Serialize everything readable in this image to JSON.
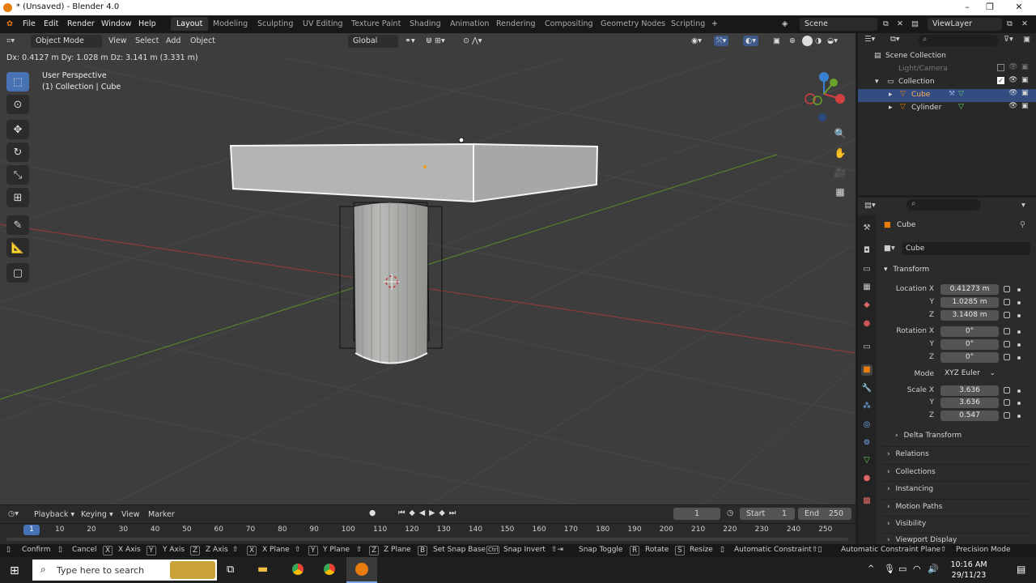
{
  "window": {
    "title": "* (Unsaved) - Blender 4.0"
  },
  "menu": [
    "File",
    "Edit",
    "Render",
    "Window",
    "Help"
  ],
  "workspaces": [
    {
      "label": "Layout",
      "active": true
    },
    {
      "label": "Modeling"
    },
    {
      "label": "Sculpting"
    },
    {
      "label": "UV Editing"
    },
    {
      "label": "Texture Paint"
    },
    {
      "label": "Shading"
    },
    {
      "label": "Animation"
    },
    {
      "label": "Rendering"
    },
    {
      "label": "Compositing"
    },
    {
      "label": "Geometry Nodes"
    },
    {
      "label": "Scripting"
    }
  ],
  "scene": {
    "name": "Scene",
    "view_layer": "ViewLayer"
  },
  "viewport_header": {
    "mode": "Object Mode",
    "menus": [
      "View",
      "Select",
      "Add",
      "Object"
    ],
    "orientation": "Global"
  },
  "viewport": {
    "delta_readout": "Dx: 0.4127 m   Dy: 1.028 m   Dz: 3.141 m (3.331 m)",
    "perspective": "User Perspective",
    "collection_info": "(1) Collection | Cube"
  },
  "outliner": {
    "rows": [
      {
        "label": "Scene Collection"
      },
      {
        "label": "Light/Camera"
      },
      {
        "label": "Collection"
      },
      {
        "label": "Cube",
        "selected": true
      },
      {
        "label": "Cylinder"
      }
    ]
  },
  "properties": {
    "object_name": "Cube",
    "data_name": "Cube",
    "transform_title": "Transform",
    "location": {
      "label": "Location X",
      "x": "0.41273 m",
      "y": "1.0285 m",
      "z": "3.1408 m"
    },
    "rotation": {
      "label": "Rotation X",
      "x": "0°",
      "y": "0°",
      "z": "0°"
    },
    "mode_label": "Mode",
    "mode_value": "XYZ Euler",
    "scale": {
      "label": "Scale X",
      "x": "3.636",
      "y": "3.636",
      "z": "0.547"
    },
    "axis_y": "Y",
    "axis_z": "Z",
    "panels": [
      "Delta Transform",
      "Relations",
      "Collections",
      "Instancing",
      "Motion Paths",
      "Visibility",
      "Viewport Display"
    ]
  },
  "timeline": {
    "menus": [
      "Playback",
      "Keying",
      "View",
      "Marker"
    ],
    "current_frame": "1",
    "start_label": "Start",
    "start": "1",
    "end_label": "End",
    "end": "250",
    "ticks": [
      "1",
      "10",
      "20",
      "30",
      "40",
      "50",
      "60",
      "70",
      "80",
      "90",
      "100",
      "110",
      "120",
      "130",
      "140",
      "150",
      "160",
      "170",
      "180",
      "190",
      "200",
      "210",
      "220",
      "230",
      "240",
      "250"
    ]
  },
  "statusbar": [
    {
      "key": "",
      "label": "Confirm"
    },
    {
      "key": "",
      "label": "Cancel"
    },
    {
      "key": "X",
      "label": "X Axis"
    },
    {
      "key": "Y",
      "label": "Y Axis"
    },
    {
      "key": "Z",
      "label": "Z Axis"
    },
    {
      "key": "X",
      "label": "X Plane"
    },
    {
      "key": "Y",
      "label": "Y Plane"
    },
    {
      "key": "Z",
      "label": "Z Plane"
    },
    {
      "key": "B",
      "label": "Set Snap Base"
    },
    {
      "key": "Ctrl",
      "label": "Snap Invert"
    },
    {
      "key": "",
      "label": "Snap Toggle"
    },
    {
      "key": "R",
      "label": "Rotate"
    },
    {
      "key": "S",
      "label": "Resize"
    },
    {
      "key": "",
      "label": "Automatic Constraint"
    },
    {
      "key": "",
      "label": "Automatic Constraint Plane"
    },
    {
      "key": "",
      "label": "Precision Mode"
    }
  ],
  "taskbar": {
    "search_placeholder": "Type here to search",
    "time": "10:16 AM",
    "date": "29/11/23"
  },
  "colors": {
    "accent": "#4772b3",
    "selected_row": "#334d80",
    "object_orange": "#e87d0d",
    "x_axis": "#d04040",
    "y_axis": "#6aa02c",
    "z_axis": "#3a80d0"
  }
}
